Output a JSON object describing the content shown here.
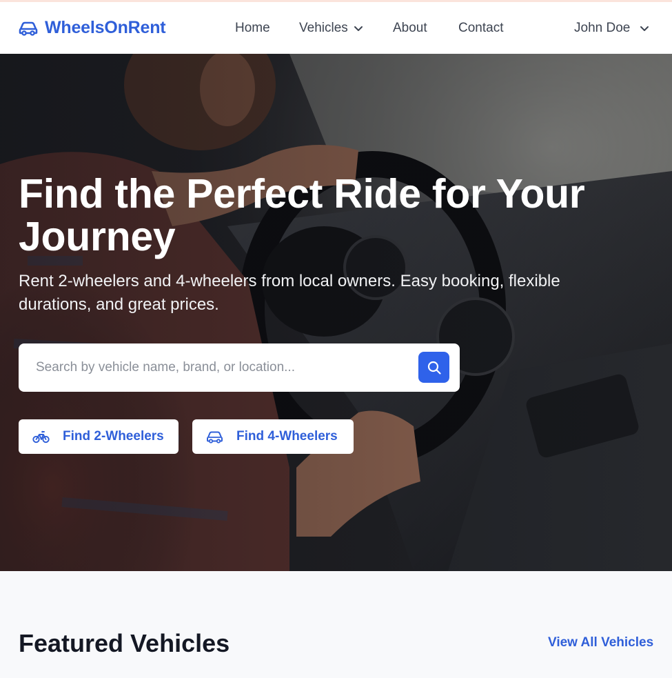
{
  "brand": {
    "name": "WheelsOnRent",
    "icon": "car-icon",
    "color": "#2f5fd9"
  },
  "nav": {
    "home": "Home",
    "vehicles": "Vehicles",
    "about": "About",
    "contact": "Contact",
    "user": "John Doe"
  },
  "hero": {
    "title": "Find the Perfect Ride for Your Journey",
    "subtitle": "Rent 2-wheelers and 4-wheelers from local owners. Easy booking, flexible durations, and great prices.",
    "search_placeholder": "Search by vehicle name, brand, or location...",
    "search_button_icon": "search-icon",
    "find_two": "Find 2-Wheelers",
    "find_two_icon": "bicycle-icon",
    "find_four": "Find 4-Wheelers",
    "find_four_icon": "car-icon",
    "accent": "#2f62ea"
  },
  "featured": {
    "title": "Featured Vehicles",
    "view_all": "View All Vehicles"
  }
}
